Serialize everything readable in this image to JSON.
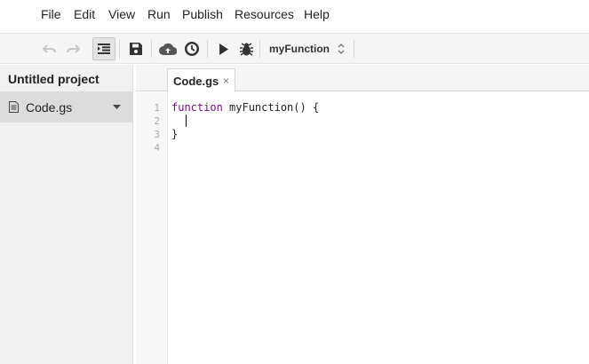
{
  "menu": [
    "File",
    "Edit",
    "View",
    "Run",
    "Publish",
    "Resources",
    "Help"
  ],
  "toolbar": {
    "function_select": "myFunction"
  },
  "sidebar": {
    "project_title": "Untitled project",
    "files": [
      {
        "label": "Code.gs"
      }
    ]
  },
  "tabs": [
    {
      "label": "Code.gs",
      "close": "×"
    }
  ],
  "editor": {
    "line_numbers": [
      "1",
      "2",
      "3",
      "4"
    ],
    "lines": [
      {
        "keyword": "function",
        "rest": " myFunction() {"
      },
      {
        "keyword": "",
        "rest": ""
      },
      {
        "keyword": "",
        "rest": "}"
      },
      {
        "keyword": "",
        "rest": ""
      }
    ]
  },
  "colors": {
    "keyword": "#7f0b8e",
    "sidebar_bg": "#f1f1f1",
    "selected_file_bg": "#dcdcdc"
  }
}
